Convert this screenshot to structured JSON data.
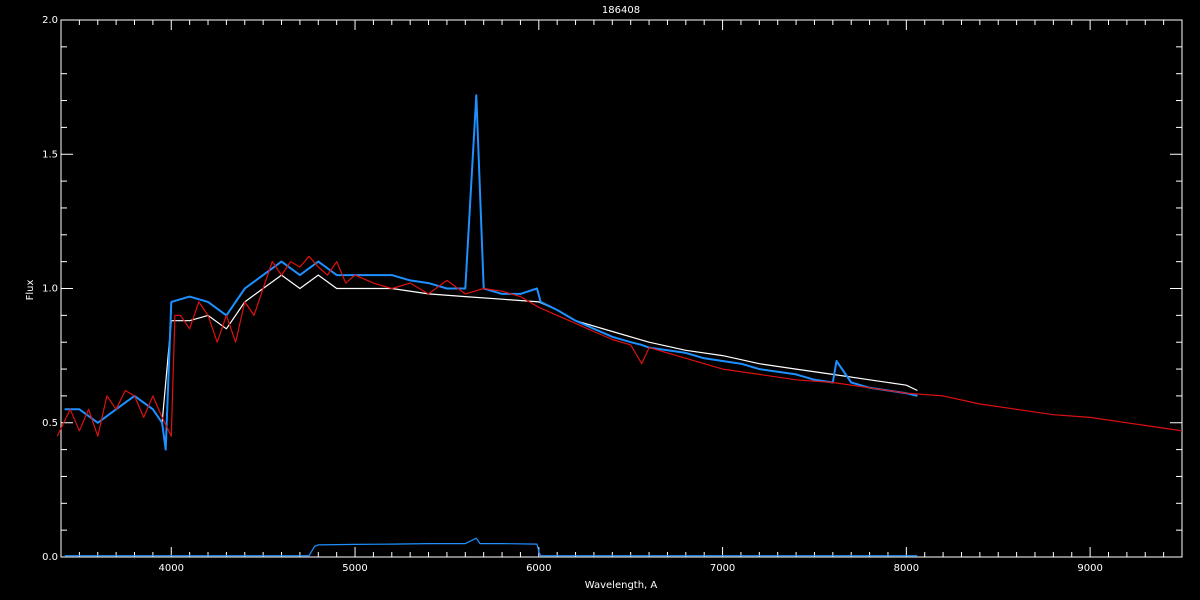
{
  "chart_data": {
    "type": "line",
    "title": "186408",
    "xlabel": "Wavelength, A",
    "ylabel": "Flux",
    "xlim": [
      3400,
      9500
    ],
    "ylim": [
      0.0,
      2.0
    ],
    "xticks": [
      4000,
      5000,
      6000,
      7000,
      8000,
      9000
    ],
    "xtick_labels": [
      "4000",
      "5000",
      "6000",
      "7000",
      "8000",
      "9000"
    ],
    "yticks": [
      0.0,
      0.5,
      1.0,
      1.5,
      2.0
    ],
    "ytick_labels": [
      "0.0",
      "0.5",
      "1.0",
      "1.5",
      "2.0"
    ],
    "grid": false,
    "colors": {
      "background": "#000000",
      "axes": "#ffffff",
      "observed": "#ffffff",
      "observed_blue": "#1e90ff",
      "model": "#dd1111",
      "error": "#1e90ff"
    },
    "series": [
      {
        "color": "observed",
        "x": [
          3420,
          3500,
          3600,
          3700,
          3800,
          3900,
          3950,
          4000,
          4100,
          4200,
          4300,
          4400,
          4500,
          4600,
          4700,
          4800,
          4900,
          5000,
          5200,
          5400,
          5600,
          5800,
          6000,
          6100,
          6200,
          6400,
          6600,
          6800,
          7000,
          7200,
          7400,
          7600,
          7800,
          8000,
          8060
        ],
        "y": [
          0.55,
          0.55,
          0.5,
          0.55,
          0.6,
          0.55,
          0.5,
          0.88,
          0.88,
          0.9,
          0.85,
          0.95,
          1.0,
          1.05,
          1.0,
          1.05,
          1.0,
          1.0,
          1.0,
          0.98,
          0.97,
          0.96,
          0.95,
          0.92,
          0.88,
          0.84,
          0.8,
          0.77,
          0.75,
          0.72,
          0.7,
          0.68,
          0.66,
          0.64,
          0.62
        ]
      },
      {
        "color": "observed_blue",
        "x": [
          3420,
          3500,
          3600,
          3700,
          3800,
          3900,
          3950,
          3970,
          4000,
          4100,
          4200,
          4300,
          4400,
          4500,
          4600,
          4700,
          4800,
          4900,
          5000,
          5100,
          5200,
          5300,
          5400,
          5500,
          5600,
          5660,
          5700,
          5800,
          5900,
          5990,
          6010,
          6100,
          6200,
          6300,
          6400,
          6500,
          6560,
          6600,
          6700,
          6800,
          6900,
          7000,
          7100,
          7200,
          7300,
          7400,
          7500,
          7600,
          7620,
          7700,
          7800,
          7900,
          8000,
          8060
        ],
        "y": [
          0.55,
          0.55,
          0.5,
          0.55,
          0.6,
          0.55,
          0.5,
          0.4,
          0.95,
          0.97,
          0.95,
          0.9,
          1.0,
          1.05,
          1.1,
          1.05,
          1.1,
          1.05,
          1.05,
          1.05,
          1.05,
          1.03,
          1.02,
          1.0,
          1.0,
          1.72,
          1.0,
          0.98,
          0.98,
          1.0,
          0.95,
          0.92,
          0.88,
          0.85,
          0.82,
          0.8,
          0.79,
          0.78,
          0.77,
          0.76,
          0.74,
          0.73,
          0.72,
          0.7,
          0.69,
          0.68,
          0.66,
          0.65,
          0.73,
          0.65,
          0.63,
          0.62,
          0.61,
          0.6
        ]
      },
      {
        "color": "model",
        "x": [
          3380,
          3450,
          3500,
          3550,
          3600,
          3650,
          3700,
          3750,
          3800,
          3850,
          3900,
          3950,
          4000,
          4020,
          4050,
          4100,
          4150,
          4200,
          4250,
          4300,
          4350,
          4400,
          4450,
          4500,
          4550,
          4600,
          4650,
          4700,
          4750,
          4800,
          4850,
          4900,
          4950,
          5000,
          5100,
          5200,
          5300,
          5400,
          5500,
          5600,
          5700,
          5800,
          5900,
          6000,
          6100,
          6200,
          6300,
          6400,
          6500,
          6560,
          6600,
          6700,
          6800,
          6900,
          7000,
          7200,
          7400,
          7600,
          7800,
          8000,
          8200,
          8400,
          8600,
          8800,
          9000,
          9200,
          9400,
          9500
        ],
        "y": [
          0.45,
          0.55,
          0.47,
          0.55,
          0.45,
          0.6,
          0.55,
          0.62,
          0.6,
          0.52,
          0.6,
          0.52,
          0.45,
          0.9,
          0.9,
          0.85,
          0.95,
          0.9,
          0.8,
          0.9,
          0.8,
          0.95,
          0.9,
          1.0,
          1.1,
          1.05,
          1.1,
          1.08,
          1.12,
          1.08,
          1.05,
          1.1,
          1.02,
          1.05,
          1.02,
          1.0,
          1.02,
          0.98,
          1.03,
          0.98,
          1.0,
          0.99,
          0.97,
          0.93,
          0.9,
          0.87,
          0.84,
          0.81,
          0.79,
          0.72,
          0.78,
          0.76,
          0.74,
          0.72,
          0.7,
          0.68,
          0.66,
          0.65,
          0.63,
          0.61,
          0.6,
          0.57,
          0.55,
          0.53,
          0.52,
          0.5,
          0.48,
          0.47
        ]
      },
      {
        "color": "error",
        "x": [
          3420,
          4750,
          4780,
          4800,
          5000,
          5200,
          5400,
          5600,
          5660,
          5680,
          5800,
          5990,
          6000,
          6010,
          8060
        ],
        "y": [
          0.005,
          0.005,
          0.04,
          0.045,
          0.047,
          0.048,
          0.05,
          0.05,
          0.07,
          0.05,
          0.05,
          0.048,
          0.02,
          0.005,
          0.005
        ]
      }
    ]
  }
}
